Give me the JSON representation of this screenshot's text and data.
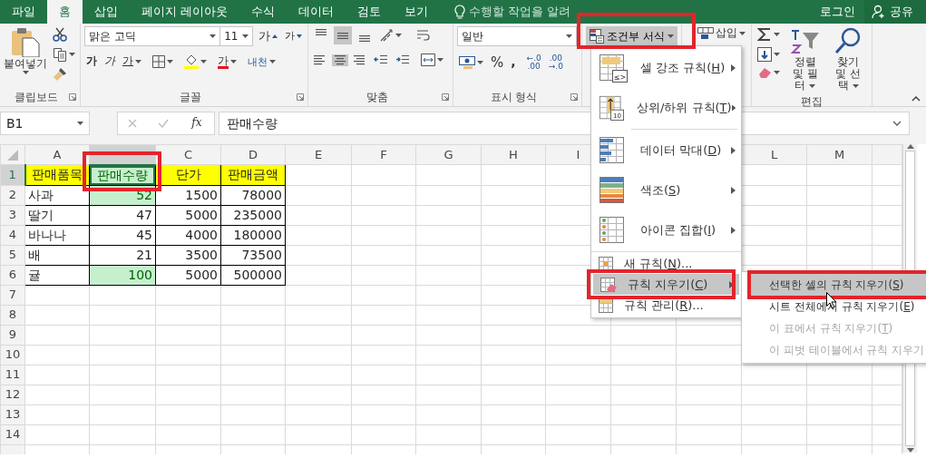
{
  "tabs": [
    {
      "label": "파일",
      "selected": false
    },
    {
      "label": "홈",
      "selected": true
    },
    {
      "label": "삽입",
      "selected": false
    },
    {
      "label": "페이지 레이아웃",
      "selected": false
    },
    {
      "label": "수식",
      "selected": false
    },
    {
      "label": "데이터",
      "selected": false
    },
    {
      "label": "검토",
      "selected": false
    },
    {
      "label": "보기",
      "selected": false
    }
  ],
  "tell_me": {
    "placeholder": "수행할 작업을 알려"
  },
  "account": {
    "login": "로그인",
    "share": "공유"
  },
  "ribbon": {
    "clipboard": {
      "paste": "붙여넣기",
      "label": "클립보드"
    },
    "font": {
      "name": "맑은 고딕",
      "size": "11",
      "grow": "가",
      "shrink": "가",
      "bold": "가",
      "italic": "가",
      "underline": "가",
      "font_color": "가",
      "phonetic": "내천",
      "label": "글꼴"
    },
    "alignment": {
      "vertical": [
        {
          "selected": false
        },
        {
          "selected": true
        },
        {
          "selected": false
        }
      ],
      "horizontal": [
        {
          "selected": false
        },
        {
          "selected": true
        },
        {
          "selected": false
        }
      ],
      "label": "맞춤"
    },
    "number": {
      "format": "일반",
      "percent": "%",
      "comma": ",",
      "increase_decimal": [
        "←.0",
        ".00"
      ],
      "decrease_decimal": [
        ".00",
        "→.0"
      ],
      "label": "표시 형식"
    },
    "styles": {
      "conditional_formatting": {
        "label": "조건부 서식",
        "pressed": true,
        "highlighted": true
      }
    },
    "cells": {
      "insert": "삽입"
    },
    "editing": {
      "sort_filter": "정렬 및 필터",
      "find_select": "찾기 및 선택",
      "label": "편집"
    }
  },
  "formula_bar": {
    "name_box": "B1",
    "function_button": "fx",
    "formula": "판매수량"
  },
  "sheet": {
    "column_headers": [
      {
        "label": "A",
        "selected": false
      },
      {
        "selected": true
      },
      {
        "label": "C",
        "selected": false
      },
      {
        "label": "D",
        "selected": false
      },
      {
        "label": "E",
        "selected": false
      },
      {
        "label": "F",
        "selected": false
      },
      {
        "label": "G",
        "selected": false
      },
      {
        "label": "H",
        "selected": false
      },
      {
        "label": "I",
        "selected": false
      }
    ],
    "column_headers_right": [
      {
        "label": "L",
        "selected": false
      },
      {
        "label": "M",
        "selected": false
      }
    ],
    "row_headers": [
      {
        "label": "1",
        "selected": true
      },
      {
        "label": "2",
        "selected": false
      },
      {
        "label": "3",
        "selected": false
      },
      {
        "label": "4",
        "selected": false
      },
      {
        "label": "5",
        "selected": false
      },
      {
        "label": "6",
        "selected": false
      },
      {
        "label": "7",
        "selected": false
      },
      {
        "label": "8",
        "selected": false
      },
      {
        "label": "9",
        "selected": false
      },
      {
        "label": "10",
        "selected": false
      },
      {
        "label": "11",
        "selected": false
      },
      {
        "label": "12",
        "selected": false
      },
      {
        "label": "13",
        "selected": false
      },
      {
        "label": "14",
        "selected": false
      }
    ],
    "rows": [
      {
        "cells": [
          {
            "text": "판매품목",
            "kind": "header",
            "highlighted": false,
            "selected": false,
            "annotated": false
          },
          {
            "text": "판매수량",
            "kind": "header",
            "highlighted": true,
            "selected": true,
            "annotated": true
          },
          {
            "text": "단가",
            "kind": "header",
            "highlighted": false,
            "selected": false,
            "annotated": false
          },
          {
            "text": "판매금액",
            "kind": "header",
            "highlighted": false,
            "selected": false,
            "annotated": false
          }
        ]
      },
      {
        "cells": [
          {
            "text": "사과",
            "kind": "text",
            "highlighted": false,
            "selected": false,
            "annotated": false
          },
          {
            "text": "52",
            "kind": "number",
            "highlighted": true,
            "selected": false,
            "annotated": false
          },
          {
            "text": "1500",
            "kind": "number",
            "highlighted": false,
            "selected": false,
            "annotated": false
          },
          {
            "text": "78000",
            "kind": "number",
            "highlighted": false,
            "selected": false,
            "annotated": false
          }
        ]
      },
      {
        "cells": [
          {
            "text": "딸기",
            "kind": "text",
            "highlighted": false,
            "selected": false,
            "annotated": false
          },
          {
            "text": "47",
            "kind": "number",
            "highlighted": false,
            "selected": false,
            "annotated": false
          },
          {
            "text": "5000",
            "kind": "number",
            "highlighted": false,
            "selected": false,
            "annotated": false
          },
          {
            "text": "235000",
            "kind": "number",
            "highlighted": false,
            "selected": false,
            "annotated": false
          }
        ]
      },
      {
        "cells": [
          {
            "text": "바나나",
            "kind": "text",
            "highlighted": false,
            "selected": false,
            "annotated": false
          },
          {
            "text": "45",
            "kind": "number",
            "highlighted": false,
            "selected": false,
            "annotated": false
          },
          {
            "text": "4000",
            "kind": "number",
            "highlighted": false,
            "selected": false,
            "annotated": false
          },
          {
            "text": "180000",
            "kind": "number",
            "highlighted": false,
            "selected": false,
            "annotated": false
          }
        ]
      },
      {
        "cells": [
          {
            "text": "배",
            "kind": "text",
            "highlighted": false,
            "selected": false,
            "annotated": false
          },
          {
            "text": "21",
            "kind": "number",
            "highlighted": false,
            "selected": false,
            "annotated": false
          },
          {
            "text": "3500",
            "kind": "number",
            "highlighted": false,
            "selected": false,
            "annotated": false
          },
          {
            "text": "73500",
            "kind": "number",
            "highlighted": false,
            "selected": false,
            "annotated": false
          }
        ]
      },
      {
        "cells": [
          {
            "text": "귤",
            "kind": "text",
            "highlighted": false,
            "selected": false,
            "annotated": false
          },
          {
            "text": "100",
            "kind": "number",
            "highlighted": true,
            "selected": false,
            "annotated": false
          },
          {
            "text": "5000",
            "kind": "number",
            "highlighted": false,
            "selected": false,
            "annotated": false
          },
          {
            "text": "500000",
            "kind": "number",
            "highlighted": false,
            "selected": false,
            "annotated": false
          }
        ]
      }
    ]
  },
  "menu": {
    "items": [
      {
        "kind": "large",
        "icon_text": "≤>",
        "label": "셀 강조 규칙(",
        "key": "H",
        "after": ")",
        "submenu": true,
        "selected": false,
        "highlighted": false
      },
      {
        "kind": "large",
        "icon_text": "10",
        "label": "상위/하위 규칙(",
        "key": "T",
        "after": ")",
        "submenu": true,
        "selected": false,
        "highlighted": false
      },
      {
        "kind": "large",
        "label": "데이터 막대(",
        "key": "D",
        "after": ")",
        "submenu": true,
        "selected": false,
        "highlighted": false,
        "divider_before": true
      },
      {
        "kind": "large",
        "label": "색조(",
        "key": "S",
        "after": ")",
        "submenu": true,
        "selected": false,
        "highlighted": false
      },
      {
        "kind": "large",
        "label": "아이콘 집합(",
        "key": "I",
        "after": ")",
        "submenu": true,
        "selected": false,
        "highlighted": false
      },
      {
        "kind": "small",
        "label": "새 규칙(",
        "key": "N",
        "after": ")...",
        "submenu": false,
        "selected": false,
        "highlighted": false,
        "divider_before": true
      },
      {
        "kind": "small",
        "label": "규칙 지우기(",
        "key": "C",
        "after": ")",
        "submenu": true,
        "selected": true,
        "highlighted": true
      },
      {
        "kind": "small",
        "label": "규칙 관리(",
        "key": "R",
        "after": ")...",
        "submenu": false,
        "selected": false,
        "highlighted": false
      }
    ]
  },
  "submenu": {
    "items": [
      {
        "label": "선택한 셀의 규칙 지우기(",
        "key": "S",
        "after": ")",
        "selected": true,
        "highlighted": true,
        "disabled": false
      },
      {
        "label": "시트 전체에서 규칙 지우기(",
        "key": "E",
        "after": ")",
        "selected": false,
        "highlighted": false,
        "disabled": false
      },
      {
        "label": "이 표에서 규칙 지우기(",
        "key": "T",
        "after": ")",
        "selected": false,
        "highlighted": false,
        "disabled": true
      },
      {
        "label": "이 피벗 테이블에서 규칙 지우기",
        "selected": false,
        "highlighted": false,
        "disabled": true
      }
    ]
  }
}
